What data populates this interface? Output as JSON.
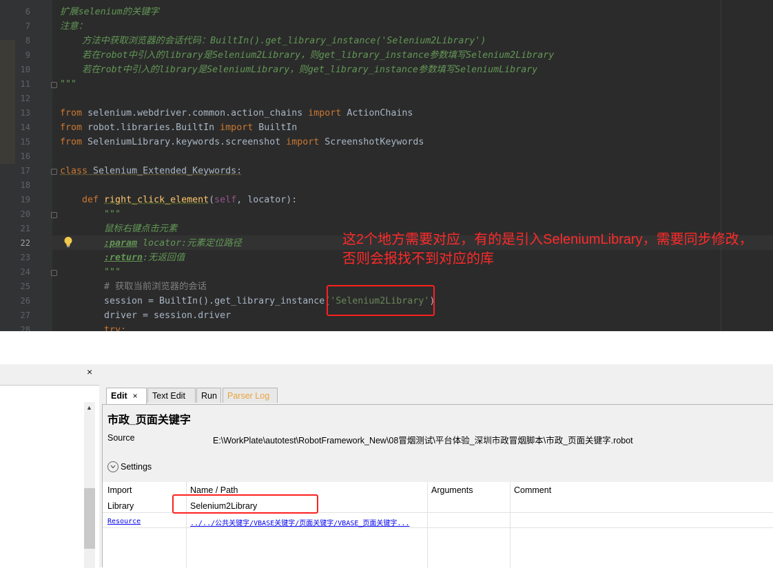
{
  "editor": {
    "line_numbers": [
      "6",
      "7",
      "8",
      "9",
      "10",
      "11",
      "12",
      "13",
      "14",
      "15",
      "16",
      "17",
      "18",
      "19",
      "20",
      "21",
      "22",
      "23",
      "24",
      "25",
      "26",
      "27",
      "28"
    ],
    "current_line": "22",
    "lines": {
      "l6": "扩展selenium的关键字",
      "l7": "注意：",
      "l8": "    方法中获取浏览器的会话代码：BuiltIn().get_library_instance('Selenium2Library')",
      "l9": "    若在robot中引入的library是Selenium2Library，则get_library_instance参数填写Selenium2Library",
      "l10": "    若在robt中引入的library是SeleniumLibrary，则get_library_instance参数填写SeleniumLibrary",
      "l11": "\"\"\"",
      "l13": {
        "kw1": "from",
        "mod": " selenium.webdriver.common.action_chains ",
        "kw2": "import",
        "name": " ActionChains"
      },
      "l14": {
        "kw1": "from",
        "mod": " robot.libraries.BuiltIn ",
        "kw2": "import",
        "name": " BuiltIn"
      },
      "l15": {
        "kw1": "from",
        "mod": " SeleniumLibrary.keywords.screenshot ",
        "kw2": "import",
        "name": " ScreenshotKeywords"
      },
      "l17": {
        "kw": "class",
        "name": " Selenium_Extended_Keywords:"
      },
      "l19": {
        "kw": "def",
        "fn": "right_click_element",
        "open": "(",
        "self": "self",
        "rest": ", locator):"
      },
      "l20": "\"\"\"",
      "l21": "鼠标右键点击元素",
      "l22": {
        "tag": ":param",
        "rest": " locator:元素定位路径"
      },
      "l23": {
        "tag": ":return",
        "rest": ":无返回值"
      },
      "l24": "\"\"\"",
      "l25": "# 获取当前浏览器的会话",
      "l26": {
        "pre": "session = BuiltIn().get_library_instance(",
        "str": "'Selenium2Library'",
        "post": ")"
      },
      "l27": "driver = session.driver",
      "l28": "try:"
    }
  },
  "annotation": "这2个地方需要对应，有的是引入SeleniumLibrary，需要同步修改，否则会报找不到对应的库",
  "ride": {
    "left_close": "×",
    "tabs": {
      "edit": "Edit",
      "edit_close": "×",
      "text_edit": "Text Edit",
      "run": "Run",
      "parser_log": "Parser Log"
    },
    "title": "市政_页面关键字",
    "source_label": "Source",
    "source_path": "E:\\WorkPlate\\autotest\\RobotFramework_New\\08冒烟测试\\平台体验_深圳市政冒烟脚本\\市政_页面关键字.robot",
    "settings_label": "Settings",
    "settings_icon": "chevron-down-icon",
    "columns": {
      "c1": "Import",
      "c2": "Name / Path",
      "c3": "Arguments",
      "c4": "Comment"
    },
    "rows": [
      {
        "type": "Library",
        "name": "Selenium2Library"
      },
      {
        "type": "Resource",
        "name": "../../公共关键字/VBASE关键字/页面关键字/VBASE_页面关键字..."
      }
    ]
  },
  "colors": {
    "annotation": "#ff2a2a",
    "highlight_box": "#ff1f1f",
    "parser_log_tab": "#e8a33d"
  }
}
